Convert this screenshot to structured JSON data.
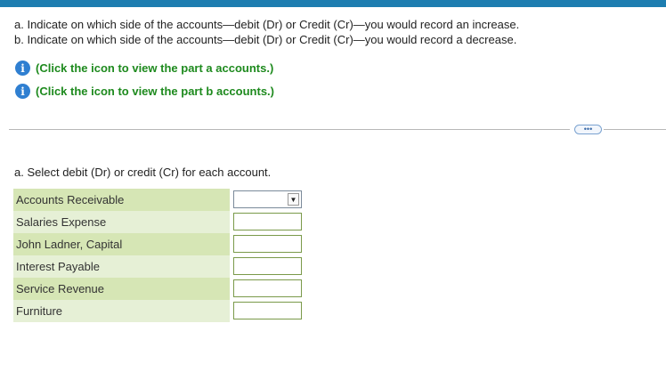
{
  "instructions": {
    "line_a": "a. Indicate on which side of the accounts—debit (Dr) or Credit (Cr)—you would record an increase.",
    "line_b": "b. Indicate on which side of the accounts—debit (Dr) or Credit (Cr)—you would record a decrease."
  },
  "info_links": [
    {
      "icon": "info-icon",
      "text": "(Click the icon to view the part a accounts.)"
    },
    {
      "icon": "info-icon",
      "text": "(Click the icon to view the part b accounts.)"
    }
  ],
  "more_button": {
    "label": "•••"
  },
  "part_a": {
    "label": "a. Select debit (Dr) or credit (Cr) for each account.",
    "accounts": [
      {
        "name": "Accounts Receivable",
        "selection": ""
      },
      {
        "name": "Salaries Expense",
        "selection": ""
      },
      {
        "name": "John Ladner, Capital",
        "selection": ""
      },
      {
        "name": "Interest Payable",
        "selection": ""
      },
      {
        "name": "Service Revenue",
        "selection": ""
      },
      {
        "name": "Furniture",
        "selection": ""
      }
    ]
  },
  "colors": {
    "top_bar": "#1d7db0",
    "info_icon": "#2f7fd1",
    "link_text": "#1e8a1e",
    "row_odd": "#d6e6b5",
    "row_even": "#e6f0d6"
  }
}
